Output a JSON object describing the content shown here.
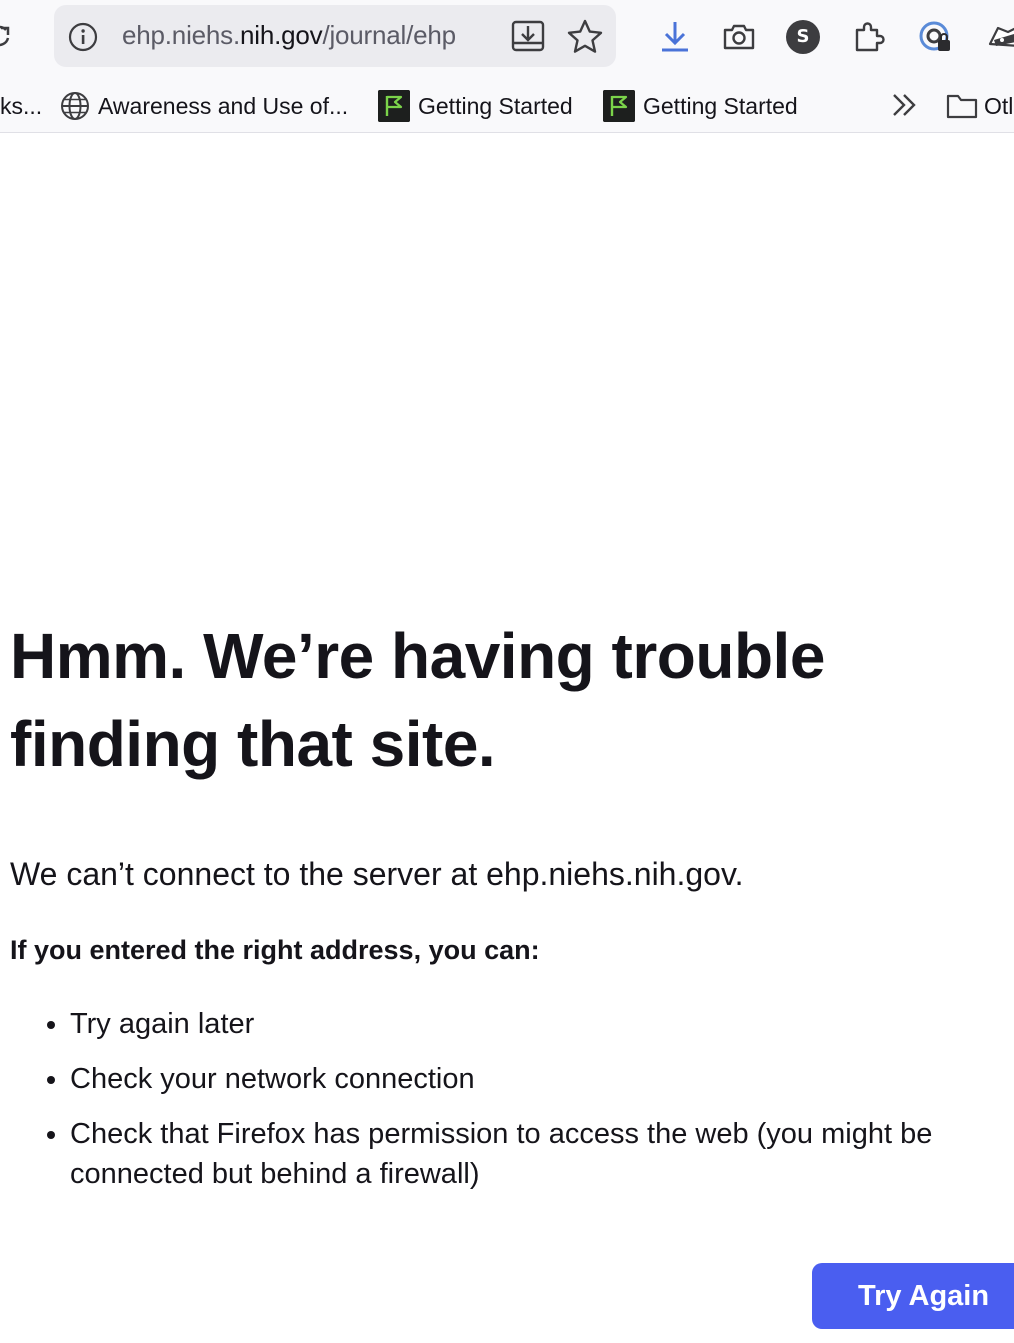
{
  "browser": {
    "url_prefix": "ehp.niehs.",
    "url_domain": "nih.gov",
    "url_path": "/journal/ehp",
    "profile_initial": "S",
    "bookmarks": [
      {
        "label": "ks...",
        "icon": "none"
      },
      {
        "label": "Awareness and Use of...",
        "icon": "globe-icon"
      },
      {
        "label": "Getting Started",
        "icon": "flag-icon"
      },
      {
        "label": "Getting Started",
        "icon": "flag-icon"
      }
    ],
    "overflow_label": "Otl",
    "accent": "#4a5ef0",
    "download_icon_color": "#4a73d8"
  },
  "error": {
    "title": "Hmm. We’re having trouble finding that site.",
    "description": "We can’t connect to the server at ehp.niehs.nih.gov.",
    "subtitle": "If you entered the right address, you can:",
    "tips": [
      "Try again later",
      "Check your network connection",
      "Check that Firefox has permission to access the web (you might be connected but behind a firewall)"
    ],
    "button_label": "Try Again"
  }
}
